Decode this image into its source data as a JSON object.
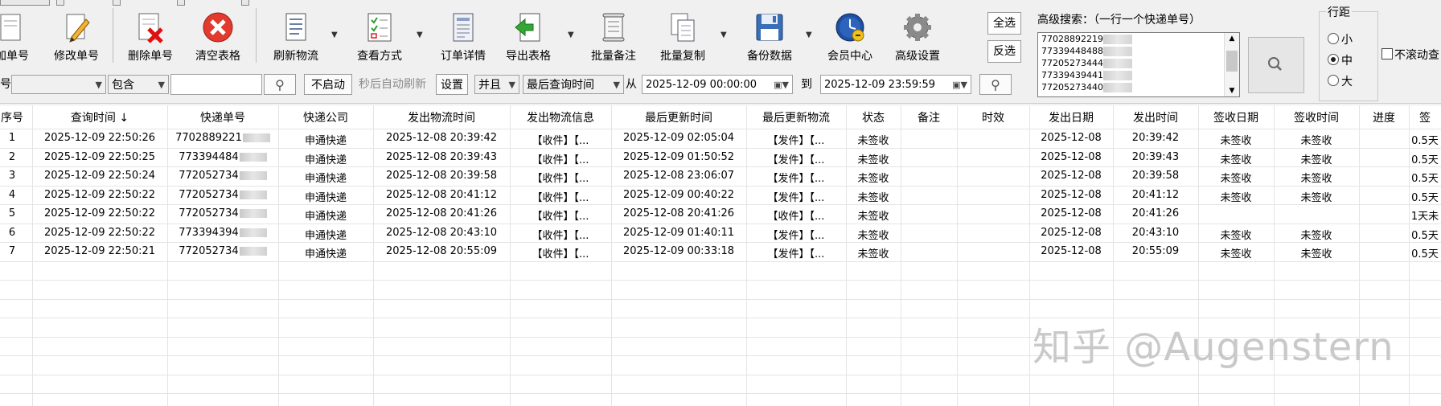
{
  "toolbar": {
    "buttons": [
      {
        "label": "加单号",
        "icon": "add-icon"
      },
      {
        "label": "修改单号",
        "icon": "pencil-icon"
      },
      {
        "label": "删除单号",
        "icon": "delete-doc-icon"
      },
      {
        "label": "清空表格",
        "icon": "clear-x-icon"
      },
      {
        "label": "刷新物流",
        "icon": "refresh-doc-icon"
      },
      {
        "label": "查看方式",
        "icon": "checklist-icon"
      },
      {
        "label": "订单详情",
        "icon": "detail-doc-icon"
      },
      {
        "label": "导出表格",
        "icon": "export-arrow-icon"
      },
      {
        "label": "批量备注",
        "icon": "note-scroll-icon"
      },
      {
        "label": "批量复制",
        "icon": "copy-docs-icon"
      },
      {
        "label": "备份数据",
        "icon": "floppy-icon"
      },
      {
        "label": "会员中心",
        "icon": "clock-member-icon"
      },
      {
        "label": "高级设置",
        "icon": "gear-icon"
      }
    ],
    "select_all": "全选",
    "invert_select": "反选"
  },
  "advanced_search": {
    "label": "高级搜索：（一行一个快递单号）",
    "lines": [
      "77028892219",
      "77339448488",
      "77205273444",
      "77339439441",
      "77205273440"
    ]
  },
  "row_spacing": {
    "title": "行距",
    "options": [
      "小",
      "中",
      "大"
    ],
    "selected": "中"
  },
  "no_scroll_label": "不滚动查",
  "filter_bar": {
    "field_label": "号:",
    "match_mode": "包含",
    "search_value": "",
    "auto_refresh_button": "不启动",
    "auto_refresh_hint": "秒后自动刷新",
    "settings_button": "设置",
    "logic": "并且",
    "time_field": "最后查询时间",
    "from_label": "从",
    "from_value": "2025-12-09 00:00:00",
    "to_label": "到",
    "to_value": "2025-12-09 23:59:59"
  },
  "table": {
    "columns": [
      "序号",
      "查询时间 ↓",
      "快递单号",
      "快递公司",
      "发出物流时间",
      "发出物流信息",
      "最后更新时间",
      "最后更新物流",
      "状态",
      "备注",
      "时效",
      "发出日期",
      "发出时间",
      "签收日期",
      "签收时间",
      "进度",
      "签"
    ],
    "rows": [
      [
        "1",
        "2025-12-09 22:50:26",
        "7702889221",
        "申通快递",
        "2025-12-08 20:39:42",
        "【收件】【...",
        "2025-12-09 02:05:04",
        "【发件】【...",
        "未签收",
        "",
        "",
        "2025-12-08",
        "20:39:42",
        "未签收",
        "未签收",
        "",
        "0.5天"
      ],
      [
        "2",
        "2025-12-09 22:50:25",
        "773394484",
        "申通快递",
        "2025-12-08 20:39:43",
        "【收件】【...",
        "2025-12-09 01:50:52",
        "【发件】【...",
        "未签收",
        "",
        "",
        "2025-12-08",
        "20:39:43",
        "未签收",
        "未签收",
        "",
        "0.5天"
      ],
      [
        "3",
        "2025-12-09 22:50:24",
        "772052734",
        "申通快递",
        "2025-12-08 20:39:58",
        "【收件】【...",
        "2025-12-08 23:06:07",
        "【发件】【...",
        "未签收",
        "",
        "",
        "2025-12-08",
        "20:39:58",
        "未签收",
        "未签收",
        "",
        "0.5天"
      ],
      [
        "4",
        "2025-12-09 22:50:22",
        "772052734",
        "申通快递",
        "2025-12-08 20:41:12",
        "【收件】【...",
        "2025-12-09 00:40:22",
        "【发件】【...",
        "未签收",
        "",
        "",
        "2025-12-08",
        "20:41:12",
        "未签收",
        "未签收",
        "",
        "0.5天"
      ],
      [
        "5",
        "2025-12-09 22:50:22",
        "772052734",
        "申通快递",
        "2025-12-08 20:41:26",
        "【收件】【...",
        "2025-12-08 20:41:26",
        "【收件】【...",
        "未签收",
        "",
        "",
        "2025-12-08",
        "20:41:26",
        "",
        "",
        "",
        "1天未"
      ],
      [
        "6",
        "2025-12-09 22:50:22",
        "773394394",
        "申通快递",
        "2025-12-08 20:43:10",
        "【收件】【...",
        "2025-12-09 01:40:11",
        "【发件】【...",
        "未签收",
        "",
        "",
        "2025-12-08",
        "20:43:10",
        "未签收",
        "未签收",
        "",
        "0.5天"
      ],
      [
        "7",
        "2025-12-09 22:50:21",
        "772052734",
        "申通快递",
        "2025-12-08 20:55:09",
        "【收件】【...",
        "2025-12-09 00:33:18",
        "【发件】【...",
        "未签收",
        "",
        "",
        "2025-12-08",
        "20:55:09",
        "未签收",
        "未签收",
        "",
        "0.5天"
      ]
    ]
  },
  "watermark": "知乎 @Augenstern"
}
